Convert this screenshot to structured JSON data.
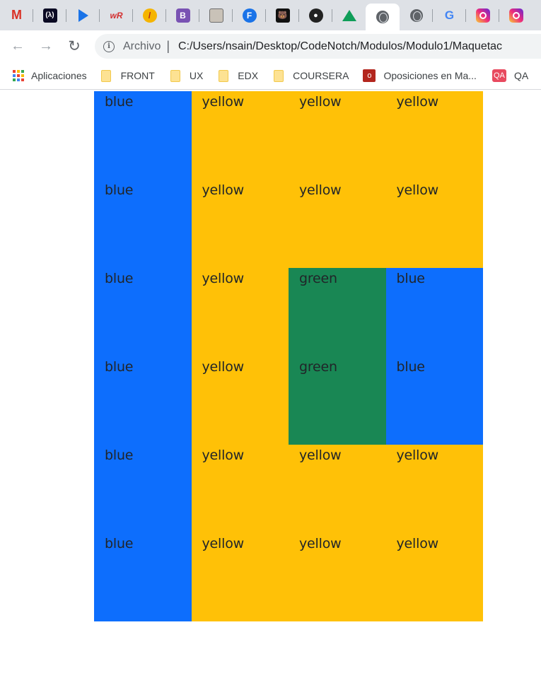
{
  "colors": {
    "blue": "#0d6efd",
    "yellow": "#ffc107",
    "green": "#198754",
    "text": "#212529"
  },
  "tabs": [
    {
      "icon": "gmail-icon",
      "glyph": "M",
      "active": false
    },
    {
      "icon": "freecodecamp-icon",
      "glyph": "(λ)",
      "active": false
    },
    {
      "icon": "play-icon",
      "glyph": "",
      "active": false
    },
    {
      "icon": "wordreference-icon",
      "glyph": "wR",
      "active": false
    },
    {
      "icon": "leaf-icon",
      "glyph": "/",
      "active": false
    },
    {
      "icon": "bootstrap-icon",
      "glyph": "B",
      "active": false
    },
    {
      "icon": "picture-icon",
      "glyph": "",
      "active": false
    },
    {
      "icon": "facebook-icon",
      "glyph": "F",
      "active": false
    },
    {
      "icon": "bear-icon",
      "glyph": "",
      "active": false
    },
    {
      "icon": "github-icon",
      "glyph": "",
      "active": false
    },
    {
      "icon": "google-drive-icon",
      "glyph": "",
      "active": false
    },
    {
      "icon": "globe-icon",
      "glyph": "",
      "active": true
    },
    {
      "icon": "globe-icon",
      "glyph": "",
      "active": false
    },
    {
      "icon": "google-icon",
      "glyph": "G",
      "active": false
    },
    {
      "icon": "instagram-icon",
      "glyph": "",
      "active": false
    },
    {
      "icon": "instagram-icon",
      "glyph": "",
      "active": false
    }
  ],
  "toolbar": {
    "back_icon": "arrow-left-icon",
    "forward_icon": "arrow-right-icon",
    "reload_icon": "reload-icon",
    "site_info_label": "Archivo",
    "url": "C:/Users/nsain/Desktop/CodeNotch/Modulos/Modulo1/Maquetac"
  },
  "bookmarks": [
    {
      "label": "Aplicaciones",
      "icon": "apps-icon"
    },
    {
      "label": "FRONT",
      "icon": "folder-icon"
    },
    {
      "label": "UX",
      "icon": "folder-icon"
    },
    {
      "label": "EDX",
      "icon": "folder-icon"
    },
    {
      "label": "COURSERA",
      "icon": "folder-icon"
    },
    {
      "label": "Oposiciones en Ma...",
      "icon": "office-icon"
    },
    {
      "label": "QA",
      "icon": "qa-icon"
    }
  ],
  "grid": {
    "cells": [
      {
        "label": "blue",
        "color": "blue"
      },
      {
        "label": "yellow",
        "color": "yellow"
      },
      {
        "label": "yellow",
        "color": "yellow"
      },
      {
        "label": "yellow",
        "color": "yellow"
      },
      {
        "label": "blue",
        "color": "blue"
      },
      {
        "label": "yellow",
        "color": "yellow"
      },
      {
        "label": "yellow",
        "color": "yellow"
      },
      {
        "label": "yellow",
        "color": "yellow"
      },
      {
        "label": "blue",
        "color": "blue"
      },
      {
        "label": "yellow",
        "color": "yellow"
      },
      {
        "label": "green",
        "color": "green"
      },
      {
        "label": "blue",
        "color": "blue"
      },
      {
        "label": "blue",
        "color": "blue"
      },
      {
        "label": "yellow",
        "color": "yellow"
      },
      {
        "label": "green",
        "color": "green"
      },
      {
        "label": "blue",
        "color": "blue"
      },
      {
        "label": "blue",
        "color": "blue"
      },
      {
        "label": "yellow",
        "color": "yellow"
      },
      {
        "label": "yellow",
        "color": "yellow"
      },
      {
        "label": "yellow",
        "color": "yellow"
      },
      {
        "label": "blue",
        "color": "blue"
      },
      {
        "label": "yellow",
        "color": "yellow"
      },
      {
        "label": "yellow",
        "color": "yellow"
      },
      {
        "label": "yellow",
        "color": "yellow"
      }
    ]
  }
}
